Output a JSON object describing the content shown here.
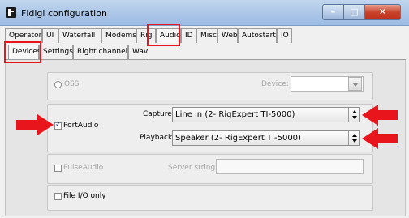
{
  "window": {
    "title": "Fldigi configuration"
  },
  "main_tabs": [
    "Operator",
    "UI",
    "Waterfall",
    "Modems",
    "Rig",
    "Audio",
    "ID",
    "Misc",
    "Web",
    "Autostart",
    "IO"
  ],
  "active_main_tab": "Audio",
  "sub_tabs": [
    "Devices",
    "Settings",
    "Right channel",
    "Wav"
  ],
  "active_sub_tab": "Devices",
  "oss": {
    "label": "OSS",
    "selected": false,
    "device_label": "Device:",
    "device_value": ""
  },
  "portaudio": {
    "label": "PortAudio",
    "checked": true,
    "capture_label": "Capture:",
    "capture_value": "Line in (2- RigExpert TI-5000)",
    "playback_label": "Playback:",
    "playback_value": "Speaker (2- RigExpert TI-5000)"
  },
  "pulseaudio": {
    "label": "PulseAudio",
    "checked": false,
    "server_label": "Server string:",
    "server_value": ""
  },
  "fileio": {
    "label": "File I/O only",
    "checked": false
  },
  "colors": {
    "annotation_red": "#e8161c",
    "titlebar": "#a9c4e6"
  }
}
